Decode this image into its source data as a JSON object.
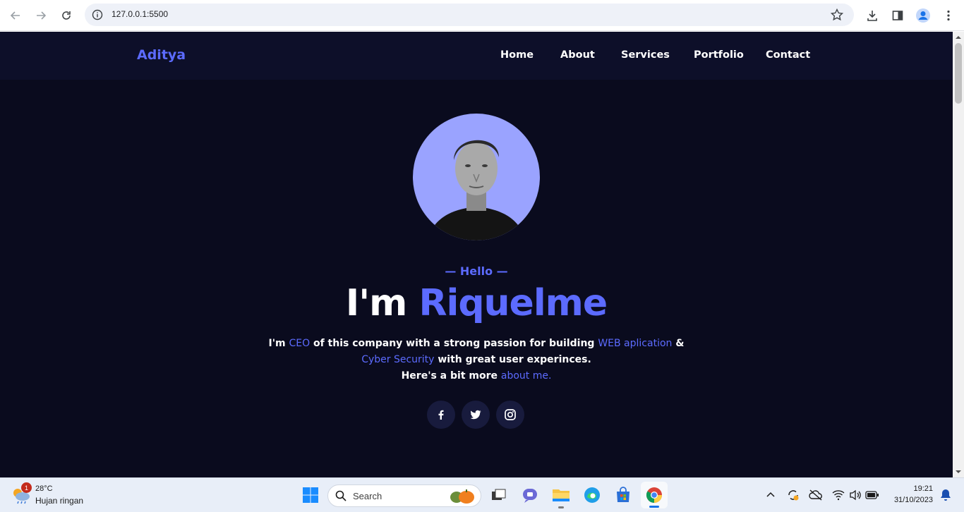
{
  "browser": {
    "url": "127.0.0.1:5500"
  },
  "site": {
    "logo": "Aditya",
    "nav": [
      "Home",
      "About",
      "Services",
      "Portfolio",
      "Contact"
    ],
    "hello": "— Hello —",
    "headline_prefix": "I'm",
    "headline_name": "Riquelme",
    "desc_line1": {
      "a": "I'm",
      "b": "CEO",
      "c": "of this company with a strong passion for building",
      "d": "WEB aplication",
      "e": "&"
    },
    "desc_line2": {
      "a": "Cyber Security",
      "b": "with great user experinces."
    },
    "desc_line3": {
      "a": "Here's a bit more",
      "b": "about me."
    },
    "social": [
      "facebook-icon",
      "twitter-icon",
      "instagram-icon"
    ],
    "colors": {
      "accent": "#5c6bff",
      "background": "#0a0b1e",
      "nav_bg": "#0d0f29",
      "avatar_bg": "#9aa3ff"
    }
  },
  "taskbar": {
    "weather_temp": "28°C",
    "weather_desc": "Hujan ringan",
    "weather_badge": "1",
    "search_placeholder": "Search",
    "time": "19:21",
    "date": "31/10/2023"
  }
}
